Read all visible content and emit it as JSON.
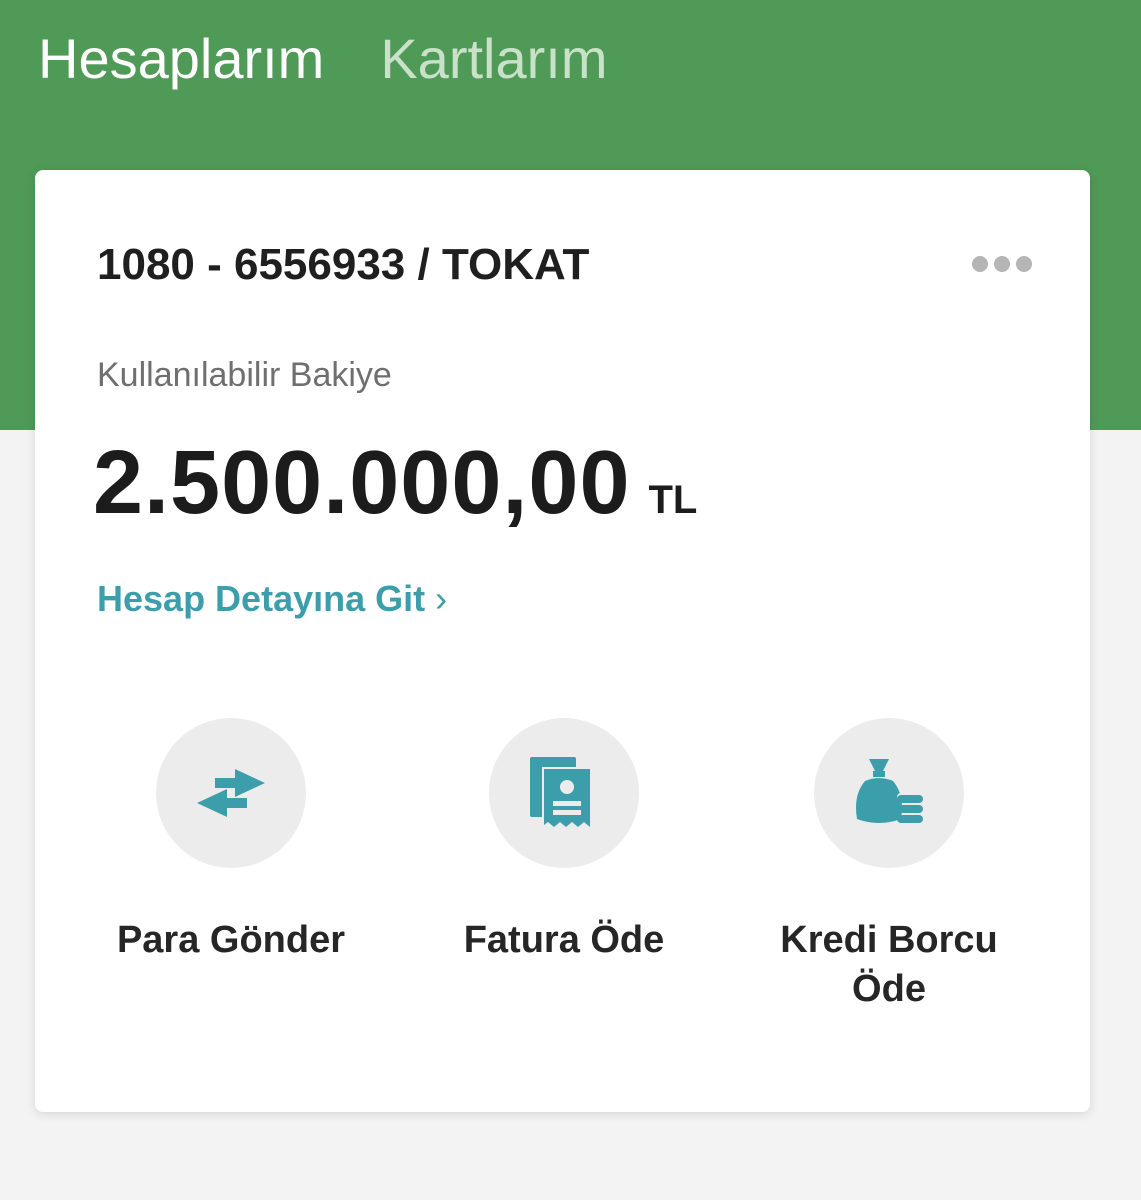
{
  "tabs": [
    {
      "label": "Hesaplarım",
      "active": true
    },
    {
      "label": "Kartlarım",
      "active": false
    }
  ],
  "account": {
    "number": "1080 - 6556933 / TOKAT",
    "balance_label": "Kullanılabilir Bakiye",
    "balance_amount": "2.500.000,00",
    "currency": "TL",
    "detail_link": "Hesap Detayına Git"
  },
  "actions": [
    {
      "label": "Para Gönder",
      "icon": "transfer-arrows-icon"
    },
    {
      "label": "Fatura Öde",
      "icon": "bill-receipt-icon"
    },
    {
      "label": "Kredi Borcu Öde",
      "icon": "money-bag-coins-icon"
    }
  ],
  "colors": {
    "header_green": "#4f9a57",
    "accent_teal": "#3d9eab",
    "icon_circle": "#ececec"
  }
}
